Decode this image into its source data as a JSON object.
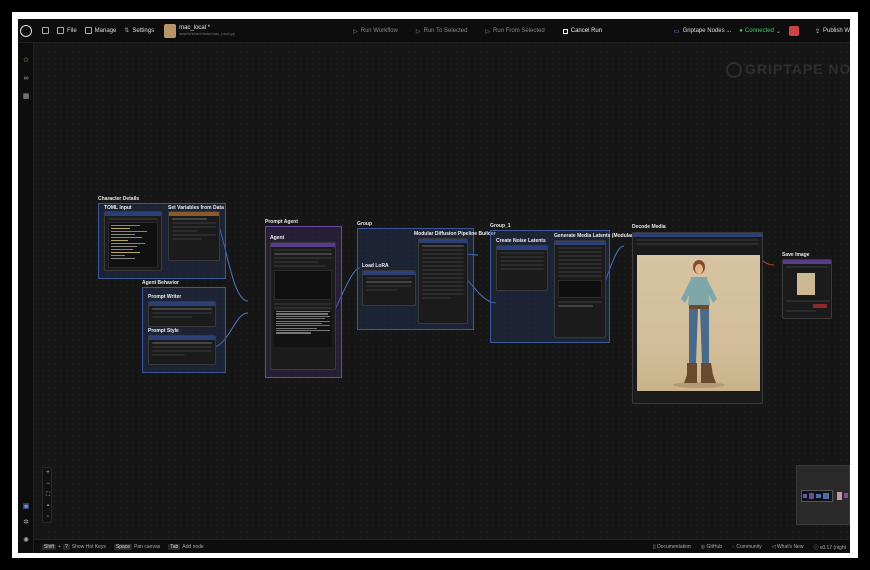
{
  "topbar": {
    "file": "File",
    "manage": "Manage",
    "settings": "Settings",
    "workflow_name": "mac_local *",
    "workflow_path": "assets/share/mac/mac_local.py",
    "run_workflow": "Run Workflow",
    "run_to_selected": "Run To Selected",
    "run_from_selected": "Run From Selected",
    "cancel_run": "Cancel Run",
    "engine_name": "Griptape Nodes ...",
    "status": "Connected",
    "publish": "Publish W"
  },
  "watermark": "GRIPTAPE NODES",
  "groups": {
    "character_details": "Character Details",
    "agent_behavior": "Agent Behavior",
    "prompt_agent": "Prompt Agent",
    "group": "Group",
    "group_1": "Group_1",
    "decode_media": "Decode Media",
    "save_image": "Save Image"
  },
  "nodes": {
    "toml_input": "TOML Input",
    "set_variables": "Set Variables from Data",
    "prompt_writer": "Prompt Writer",
    "prompt_style": "Prompt Style",
    "agent": "Agent",
    "load_lora": "Load LoRA",
    "modular_diffusion": "Modular Diffusion Pipeline Builder",
    "create_noise": "Create Noise Latents",
    "generate_media": "Generate Media Latents (Modular"
  },
  "bottombar": {
    "shift": "Shift",
    "question": "?",
    "show_hot_keys": "Show Hot Keys",
    "space": "Space",
    "pan_canvas": "Pan canvas",
    "tab": "Tab",
    "add_node": "Add node",
    "documentation": "Documentation",
    "github": "GitHub",
    "community": "Community",
    "whats_new": "What's New",
    "version": "v0.17 (night"
  },
  "colors": {
    "accent_blue": "#3c5a9a",
    "accent_purple": "#6a4a9a",
    "connected_green": "#44cc66",
    "wire_blue": "#4a78c8",
    "wire_red": "#c83a3a"
  }
}
